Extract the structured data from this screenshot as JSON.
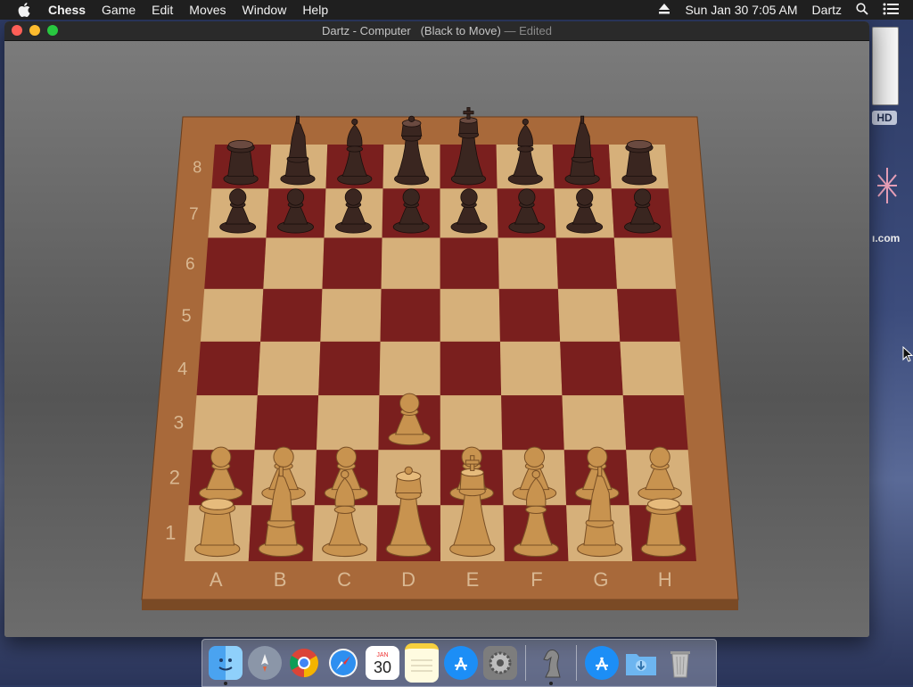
{
  "menubar": {
    "app_name": "Chess",
    "items": [
      "Game",
      "Edit",
      "Moves",
      "Window",
      "Help"
    ],
    "clock": "Sun Jan 30  7:05 AM",
    "user": "Dartz"
  },
  "desktop": {
    "disk_label_fragment": "HD",
    "site_label_fragment": "ı.com"
  },
  "window": {
    "title": "Dartz - Computer",
    "status": "(Black to Move)",
    "edited": "— Edited"
  },
  "board": {
    "files": [
      "A",
      "B",
      "C",
      "D",
      "E",
      "F",
      "G",
      "H"
    ],
    "ranks": [
      "1",
      "2",
      "3",
      "4",
      "5",
      "6",
      "7",
      "8"
    ],
    "light_square": "#d6b07a",
    "dark_square": "#7a1f1e",
    "frame_color": "#a8693a",
    "pieces": [
      {
        "sq": "a8",
        "p": "r",
        "c": "black"
      },
      {
        "sq": "b8",
        "p": "n",
        "c": "black"
      },
      {
        "sq": "c8",
        "p": "b",
        "c": "black"
      },
      {
        "sq": "d8",
        "p": "q",
        "c": "black"
      },
      {
        "sq": "e8",
        "p": "k",
        "c": "black"
      },
      {
        "sq": "f8",
        "p": "b",
        "c": "black"
      },
      {
        "sq": "g8",
        "p": "n",
        "c": "black"
      },
      {
        "sq": "h8",
        "p": "r",
        "c": "black"
      },
      {
        "sq": "a7",
        "p": "p",
        "c": "black"
      },
      {
        "sq": "b7",
        "p": "p",
        "c": "black"
      },
      {
        "sq": "c7",
        "p": "p",
        "c": "black"
      },
      {
        "sq": "d7",
        "p": "p",
        "c": "black"
      },
      {
        "sq": "e7",
        "p": "p",
        "c": "black"
      },
      {
        "sq": "f7",
        "p": "p",
        "c": "black"
      },
      {
        "sq": "g7",
        "p": "p",
        "c": "black"
      },
      {
        "sq": "h7",
        "p": "p",
        "c": "black"
      },
      {
        "sq": "a2",
        "p": "p",
        "c": "white"
      },
      {
        "sq": "b2",
        "p": "p",
        "c": "white"
      },
      {
        "sq": "c2",
        "p": "p",
        "c": "white"
      },
      {
        "sq": "d3",
        "p": "p",
        "c": "white"
      },
      {
        "sq": "e2",
        "p": "p",
        "c": "white"
      },
      {
        "sq": "f2",
        "p": "p",
        "c": "white"
      },
      {
        "sq": "g2",
        "p": "p",
        "c": "white"
      },
      {
        "sq": "h2",
        "p": "p",
        "c": "white"
      },
      {
        "sq": "a1",
        "p": "r",
        "c": "white"
      },
      {
        "sq": "b1",
        "p": "n",
        "c": "white"
      },
      {
        "sq": "c1",
        "p": "b",
        "c": "white"
      },
      {
        "sq": "d1",
        "p": "q",
        "c": "white"
      },
      {
        "sq": "e1",
        "p": "k",
        "c": "white"
      },
      {
        "sq": "f1",
        "p": "b",
        "c": "white"
      },
      {
        "sq": "g1",
        "p": "n",
        "c": "white"
      },
      {
        "sq": "h1",
        "p": "r",
        "c": "white"
      }
    ]
  },
  "dock": {
    "apps": [
      "finder-icon",
      "launchpad-icon",
      "chrome-icon",
      "safari-icon",
      "calendar-icon",
      "notes-icon",
      "app-store-icon",
      "system-preferences-icon",
      "chess-icon",
      "app-store-downloads-icon",
      "downloads-folder-icon",
      "trash-icon"
    ],
    "calendar_month": "JAN",
    "calendar_day": "30"
  }
}
